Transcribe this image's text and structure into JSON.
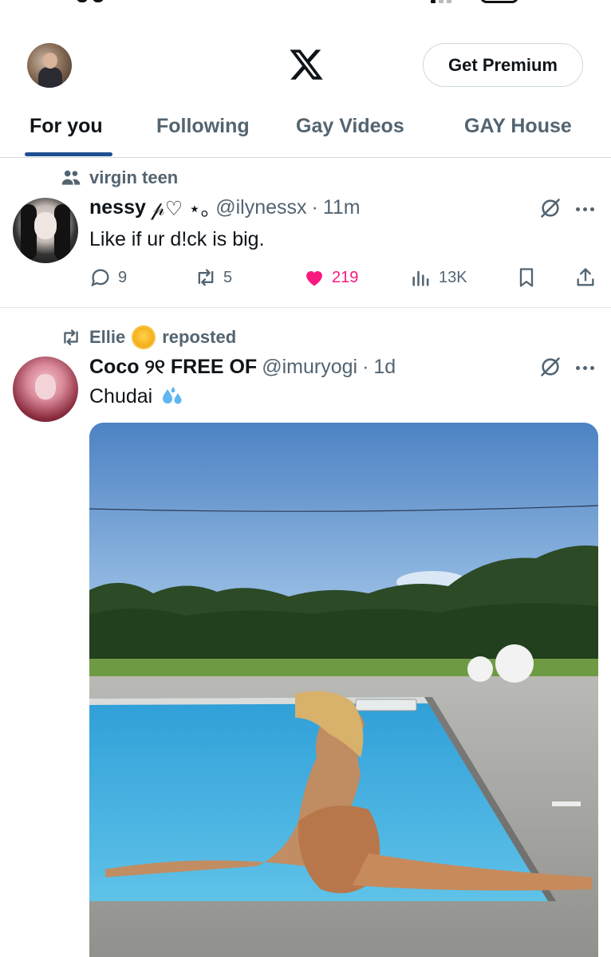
{
  "colors": {
    "text_primary": "#0f1419",
    "text_secondary": "#536471",
    "tab_indicator": "#1d4f91",
    "like": "#f91880",
    "border": "#cfd9de"
  },
  "header": {
    "logo_icon": "x-logo-icon",
    "premium_label": "Get Premium"
  },
  "tabs": [
    {
      "label": "For you",
      "active": true
    },
    {
      "label": "Following",
      "active": false
    },
    {
      "label": "Gay Videos",
      "active": false
    },
    {
      "label": "GAY House",
      "active": false
    }
  ],
  "posts": [
    {
      "context": {
        "icon": "community-icon",
        "text": "virgin teen"
      },
      "author_name": "nessy",
      "name_decoration": "𝓅♡ ⋆｡",
      "handle": "@ilynessx",
      "separator": "·",
      "time": "11m",
      "text": "Like if ur d!ck is big.",
      "stats": {
        "replies": "9",
        "reposts": "5",
        "likes": "219",
        "views": "13K"
      }
    },
    {
      "context": {
        "icon": "repost-icon",
        "user": "Ellie",
        "emoji": "sun-emoji",
        "action": "reposted"
      },
      "author_name": "Coco ୨୧ FREE OF",
      "handle": "@imuryogi",
      "separator": "·",
      "time": "1d",
      "text": "Chudai",
      "emoji": "sweat-droplets-emoji",
      "has_media": true
    }
  ]
}
